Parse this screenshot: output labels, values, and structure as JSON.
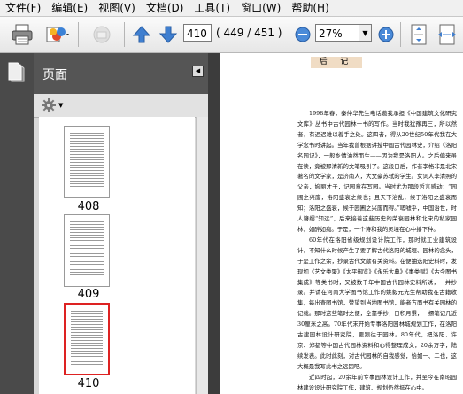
{
  "menu": {
    "items": [
      "文件(F)",
      "编辑(E)",
      "视图(V)",
      "文档(D)",
      "工具(T)",
      "窗口(W)",
      "帮助(H)"
    ]
  },
  "toolbar": {
    "page_number": "410",
    "page_count": "( 449 / 451 )",
    "zoom": "27%"
  },
  "panel": {
    "title": "页面",
    "thumbnails": [
      {
        "label": "408",
        "selected": false
      },
      {
        "label": "409",
        "selected": false
      },
      {
        "label": "410",
        "selected": true
      }
    ]
  },
  "document": {
    "header": "后 记",
    "paragraphs": [
      "1998年春，秦仲华先生电话邀我承担《中国建筑文化研究文库》丛书中古代园林一书的写作。当时我犹豫再三，所以然者，有迟迟难以着手之处。这四者，得从20世纪50年代我在大学念书时讲起。当年我曾根据讲授中国古代园林史，介绍《洛阳名园记》，一般乡情油然而生——因为我是洛阳人。之后偏来虽在读，竟被那清新的文笔吸引了。这段日后，作者李格非是北宋著名的文学家，是济南人，大文豪苏轼的学生。女词人李清照的父亲，婉丽才子，记园意在写园。当时尤为那段哲言感动：“园圃之兴废，洛阳盛衰之候也；且天下治乱，候于洛阳之盛衰而知；洛阳之盛衰，候于园圃之兴废而得。”嗟嘘乎，中国治世，时人簪缨“知远”，后来接着这些历史的荣衰园林和北宋的私家园林，如醉如痴。于是，一个诗和我的灵境在心中播下种。",
      "60年代在洛阳省级规划设计院工作，那时就工业建筑设计，不知什么时候产生了要了解古代洛阳的城垣、园林的念头，于是工作之余，抄录古代文献有关资料。在便抽选阳史料时，发现如《艺文类聚》《太平御览》《永乐大典》《事类赋》《古今图书集成》等类书时，又被数千年中国古代园林史料所诱，一并抄录。并请在河南大学图书馆工作的姚毅元先生帮助我在古籍收集，每出查图书馆，赞望到当地图书馆，能者方面书有关园林的记载。那时这些笔时之便，全靠手抄，日积月累，一摞笔记几近30厘米之高。70年代末开始专事洛阳园林城规划工作，在洛阳古建园林设计研究院，更跟往于园林。80年代，把洛阳、许京、郑都等中国古代园林资料和心得整理成文，20余万字，陆续发表。此时此刻，对古代园林的自我感觉，恰如一、二也，这大概是我写此书之远因吧。",
      "近四时起，20余年前专事园林设计工作，并至今在南昭园林建设设计研究院工作，建筑、规划仍然挺在心中。"
    ]
  },
  "colors": {
    "dark_panel": "#4a4a4a",
    "selection": "#dd2222",
    "header_tint": "#f0dcc4"
  }
}
